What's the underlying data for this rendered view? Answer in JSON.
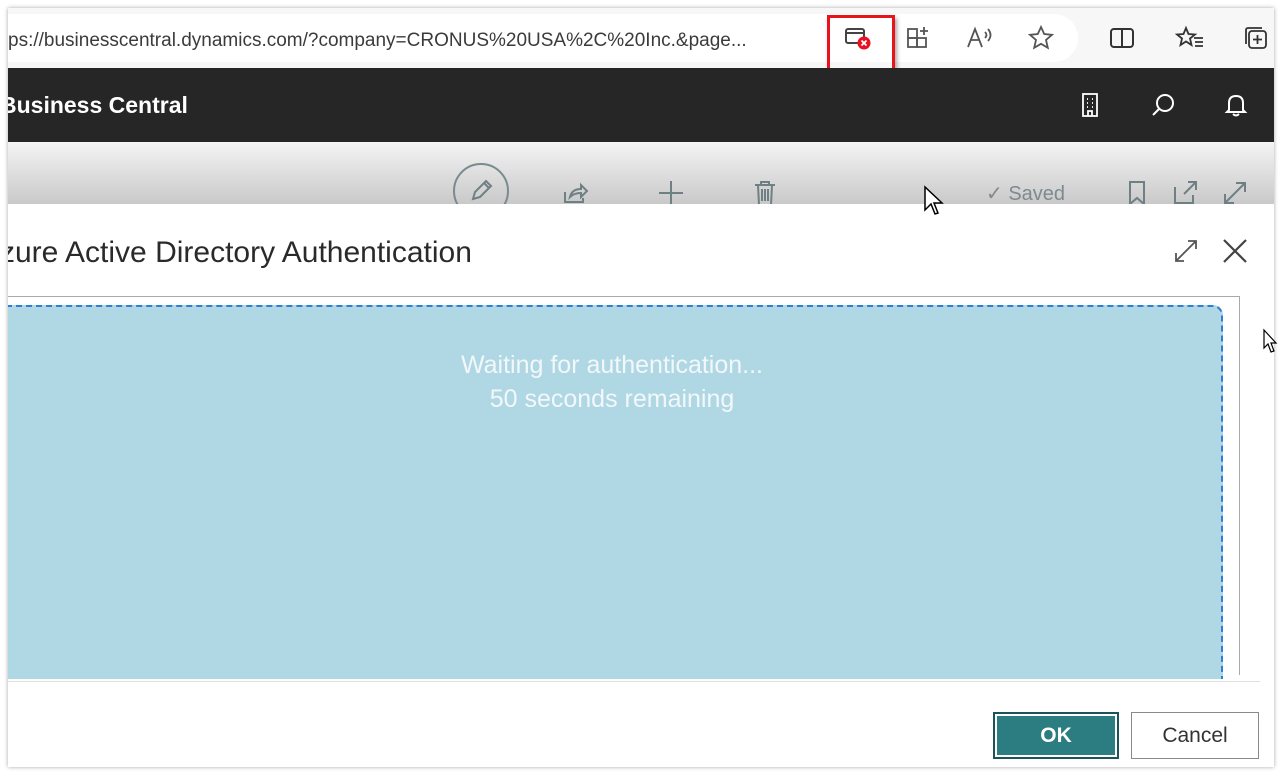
{
  "browser": {
    "url": "ps://businesscentral.dynamics.com/?company=CRONUS%20USA%2C%20Inc.&page...",
    "toolbar_icons": [
      "popup-blocked-icon",
      "app-available-icon",
      "read-aloud-icon",
      "favorite-star-icon",
      "split-screen-icon",
      "favorites-icon",
      "collections-icon"
    ],
    "highlight_color": "#e8141c"
  },
  "app": {
    "title": "Business Central",
    "header_icons": [
      "company-icon",
      "search-icon",
      "notifications-icon"
    ],
    "header_bg": "#262626"
  },
  "action_bar": {
    "icons": [
      "edit-icon",
      "share-icon",
      "new-icon",
      "delete-icon",
      "bookmark-icon",
      "open-new-window-icon",
      "expand-icon"
    ],
    "saved_label": "Saved"
  },
  "dialog": {
    "title": "zure Active Directory Authentication",
    "status_line1": "Waiting for authentication...",
    "status_line2": "50 seconds remaining",
    "panel_color": "#b0d7e4",
    "ok_label": "OK",
    "cancel_label": "Cancel",
    "accent": "#2b7d82"
  }
}
